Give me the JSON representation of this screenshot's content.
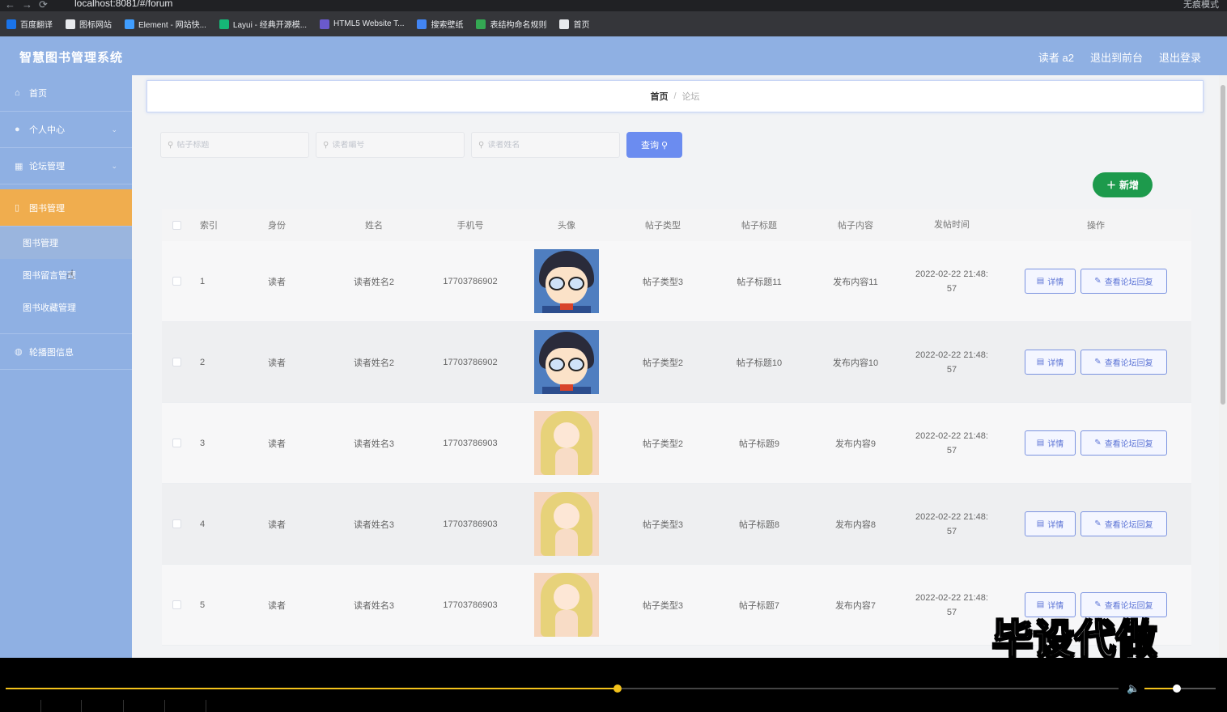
{
  "browser": {
    "url": "localhost:8081/#/forum",
    "mode_label": "无痕模式",
    "bookmarks": [
      {
        "label": "百度翻译",
        "color": "#1a73e8"
      },
      {
        "label": "图标网站",
        "color": "#e8eaed"
      },
      {
        "label": "Element - 网站快...",
        "color": "#409eff"
      },
      {
        "label": "Layui - 经典开源模...",
        "color": "#16b777"
      },
      {
        "label": "HTML5 Website T...",
        "color": "#6a5acd"
      },
      {
        "label": "搜索壁纸",
        "color": "#4285f4"
      },
      {
        "label": "表结构命名规则",
        "color": "#34a853"
      },
      {
        "label": "首页",
        "color": "#e8eaed"
      }
    ]
  },
  "header": {
    "title": "智慧图书管理系统",
    "user": "读者 a2",
    "back_front": "退出到前台",
    "logout": "退出登录"
  },
  "sidebar": {
    "home": "首页",
    "personal": "个人中心",
    "forum": "论坛管理",
    "books": "图书管理",
    "sub": [
      "图书管理",
      "图书留言管理",
      "图书收藏管理"
    ],
    "carousel": "轮播图信息"
  },
  "breadcrumb": {
    "home": "首页",
    "current": "论坛"
  },
  "search": {
    "title_placeholder": "帖子标题",
    "reader_no_placeholder": "读者编号",
    "reader_name_placeholder": "读者姓名",
    "query_label": "查询"
  },
  "add_label": "新增",
  "table": {
    "headers": [
      "索引",
      "身份",
      "姓名",
      "手机号",
      "头像",
      "帖子类型",
      "帖子标题",
      "帖子内容",
      "发帖时间",
      "操作"
    ],
    "detail_label": "详情",
    "reply_label": "查看论坛回复",
    "rows": [
      {
        "index": "1",
        "role": "读者",
        "name": "读者姓名2",
        "phone": "17703786902",
        "avatar": "conan",
        "type": "帖子类型3",
        "title": "帖子标题11",
        "content": "发布内容11",
        "time1": "2022-02-22 21:48:",
        "time2": "57"
      },
      {
        "index": "2",
        "role": "读者",
        "name": "读者姓名2",
        "phone": "17703786902",
        "avatar": "conan",
        "type": "帖子类型2",
        "title": "帖子标题10",
        "content": "发布内容10",
        "time1": "2022-02-22 21:48:",
        "time2": "57"
      },
      {
        "index": "3",
        "role": "读者",
        "name": "读者姓名3",
        "phone": "17703786903",
        "avatar": "girl",
        "type": "帖子类型2",
        "title": "帖子标题9",
        "content": "发布内容9",
        "time1": "2022-02-22 21:48:",
        "time2": "57"
      },
      {
        "index": "4",
        "role": "读者",
        "name": "读者姓名3",
        "phone": "17703786903",
        "avatar": "girl",
        "type": "帖子类型3",
        "title": "帖子标题8",
        "content": "发布内容8",
        "time1": "2022-02-22 21:48:",
        "time2": "57"
      },
      {
        "index": "5",
        "role": "读者",
        "name": "读者姓名3",
        "phone": "17703786903",
        "avatar": "girl",
        "type": "帖子类型3",
        "title": "帖子标题7",
        "content": "发布内容7",
        "time1": "2022-02-22 21:48:",
        "time2": "57"
      }
    ]
  },
  "watermark": "毕设代做",
  "player": {
    "progress": 0.55,
    "volume": 0.45
  },
  "colors": {
    "header": "#8fb0e3",
    "active_menu": "#f0ad4e",
    "primary": "#6b8cf0",
    "success": "#1d9a4c",
    "player_accent": "#f3c21b"
  }
}
